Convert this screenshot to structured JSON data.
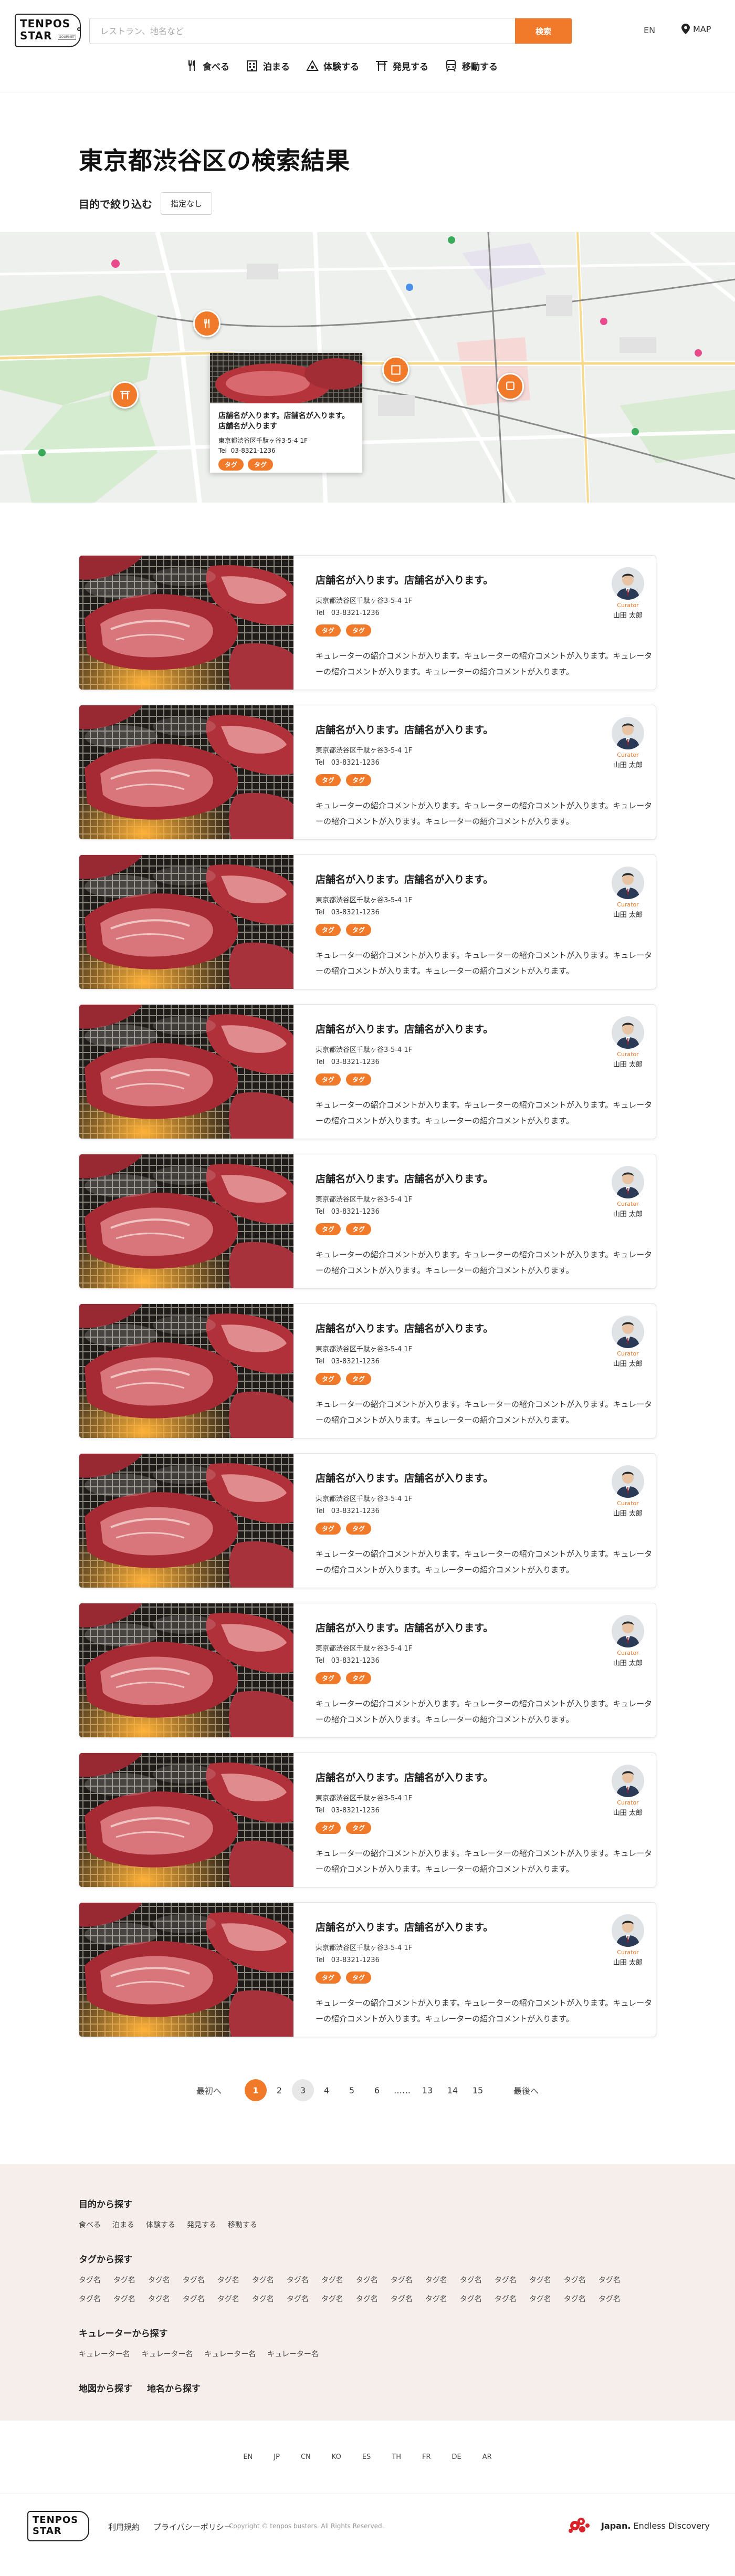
{
  "header": {
    "logo_line1": "TENPOS",
    "logo_line2": "STAR",
    "logo_badge": "GOURMET",
    "search_placeholder": "レストラン、地名など",
    "search_button": "検索",
    "lang": "EN",
    "map_label": "MAP",
    "nav": [
      {
        "label": "食べる",
        "icon": "fork-knife-icon"
      },
      {
        "label": "泊まる",
        "icon": "hotel-building-icon"
      },
      {
        "label": "体験する",
        "icon": "experience-icon"
      },
      {
        "label": "発見する",
        "icon": "torii-gate-icon"
      },
      {
        "label": "移動する",
        "icon": "train-icon"
      }
    ]
  },
  "title": {
    "text": "東京都渋谷区の検索結果",
    "filter_label": "目的で絞り込む",
    "filter_button": "指定なし"
  },
  "map_popup": {
    "name": "店舗名が入ります。店舗名が入ります。店舗名が入ります",
    "address": "東京都渋谷区千駄ヶ谷3-5-4 1F",
    "tel_label": "Tel",
    "tel": "03-8321-1236",
    "tags": [
      "タグ",
      "タグ"
    ]
  },
  "map": {
    "accent": "#f07a2a"
  },
  "results": [
    {
      "name": "店舗名が入ります。店舗名が入ります。",
      "address": "東京都渋谷区千駄ヶ谷3-5-4 1F",
      "tel_label": "Tel",
      "tel": "03-8321-1236",
      "tags": [
        "タグ",
        "タグ"
      ],
      "comment": "キュレーターの紹介コメントが入ります。キュレーターの紹介コメントが入ります。キュレーターの紹介コメントが入ります。キュレーターの紹介コメントが入ります。",
      "curator_role": "Curator",
      "curator_name": "山田 太郎"
    },
    {
      "name": "店舗名が入ります。店舗名が入ります。",
      "address": "東京都渋谷区千駄ヶ谷3-5-4 1F",
      "tel_label": "Tel",
      "tel": "03-8321-1236",
      "tags": [
        "タグ",
        "タグ"
      ],
      "comment": "キュレーターの紹介コメントが入ります。キュレーターの紹介コメントが入ります。キュレーターの紹介コメントが入ります。キュレーターの紹介コメントが入ります。",
      "curator_role": "Curator",
      "curator_name": "山田 太郎"
    },
    {
      "name": "店舗名が入ります。店舗名が入ります。",
      "address": "東京都渋谷区千駄ヶ谷3-5-4 1F",
      "tel_label": "Tel",
      "tel": "03-8321-1236",
      "tags": [
        "タグ",
        "タグ"
      ],
      "comment": "キュレーターの紹介コメントが入ります。キュレーターの紹介コメントが入ります。キュレーターの紹介コメントが入ります。キュレーターの紹介コメントが入ります。",
      "curator_role": "Curator",
      "curator_name": "山田 太郎"
    },
    {
      "name": "店舗名が入ります。店舗名が入ります。",
      "address": "東京都渋谷区千駄ヶ谷3-5-4 1F",
      "tel_label": "Tel",
      "tel": "03-8321-1236",
      "tags": [
        "タグ",
        "タグ"
      ],
      "comment": "キュレーターの紹介コメントが入ります。キュレーターの紹介コメントが入ります。キュレーターの紹介コメントが入ります。キュレーターの紹介コメントが入ります。",
      "curator_role": "Curator",
      "curator_name": "山田 太郎"
    },
    {
      "name": "店舗名が入ります。店舗名が入ります。",
      "address": "東京都渋谷区千駄ヶ谷3-5-4 1F",
      "tel_label": "Tel",
      "tel": "03-8321-1236",
      "tags": [
        "タグ",
        "タグ"
      ],
      "comment": "キュレーターの紹介コメントが入ります。キュレーターの紹介コメントが入ります。キュレーターの紹介コメントが入ります。キュレーターの紹介コメントが入ります。",
      "curator_role": "Curator",
      "curator_name": "山田 太郎"
    },
    {
      "name": "店舗名が入ります。店舗名が入ります。",
      "address": "東京都渋谷区千駄ヶ谷3-5-4 1F",
      "tel_label": "Tel",
      "tel": "03-8321-1236",
      "tags": [
        "タグ",
        "タグ"
      ],
      "comment": "キュレーターの紹介コメントが入ります。キュレーターの紹介コメントが入ります。キュレーターの紹介コメントが入ります。キュレーターの紹介コメントが入ります。",
      "curator_role": "Curator",
      "curator_name": "山田 太郎"
    },
    {
      "name": "店舗名が入ります。店舗名が入ります。",
      "address": "東京都渋谷区千駄ヶ谷3-5-4 1F",
      "tel_label": "Tel",
      "tel": "03-8321-1236",
      "tags": [
        "タグ",
        "タグ"
      ],
      "comment": "キュレーターの紹介コメントが入ります。キュレーターの紹介コメントが入ります。キュレーターの紹介コメントが入ります。キュレーターの紹介コメントが入ります。",
      "curator_role": "Curator",
      "curator_name": "山田 太郎"
    },
    {
      "name": "店舗名が入ります。店舗名が入ります。",
      "address": "東京都渋谷区千駄ヶ谷3-5-4 1F",
      "tel_label": "Tel",
      "tel": "03-8321-1236",
      "tags": [
        "タグ",
        "タグ"
      ],
      "comment": "キュレーターの紹介コメントが入ります。キュレーターの紹介コメントが入ります。キュレーターの紹介コメントが入ります。キュレーターの紹介コメントが入ります。",
      "curator_role": "Curator",
      "curator_name": "山田 太郎"
    },
    {
      "name": "店舗名が入ります。店舗名が入ります。",
      "address": "東京都渋谷区千駄ヶ谷3-5-4 1F",
      "tel_label": "Tel",
      "tel": "03-8321-1236",
      "tags": [
        "タグ",
        "タグ"
      ],
      "comment": "キュレーターの紹介コメントが入ります。キュレーターの紹介コメントが入ります。キュレーターの紹介コメントが入ります。キュレーターの紹介コメントが入ります。",
      "curator_role": "Curator",
      "curator_name": "山田 太郎"
    },
    {
      "name": "店舗名が入ります。店舗名が入ります。",
      "address": "東京都渋谷区千駄ヶ谷3-5-4 1F",
      "tel_label": "Tel",
      "tel": "03-8321-1236",
      "tags": [
        "タグ",
        "タグ"
      ],
      "comment": "キュレーターの紹介コメントが入ります。キュレーターの紹介コメントが入ります。キュレーターの紹介コメントが入ります。キュレーターの紹介コメントが入ります。",
      "curator_role": "Curator",
      "curator_name": "山田 太郎"
    }
  ],
  "pagination": {
    "prev": "最初へ",
    "pages": [
      "1",
      "2",
      "3",
      "4",
      "5",
      "6",
      "……",
      "13",
      "14",
      "15"
    ],
    "current": "1",
    "hover": "3",
    "next": "最後へ"
  },
  "footer_links": {
    "purpose_title": "目的から探す",
    "purpose_items": [
      "食べる",
      "泊まる",
      "体験する",
      "発見する",
      "移動する"
    ],
    "tag_title": "タグから探す",
    "tag_items": [
      "タグ名",
      "タグ名",
      "タグ名",
      "タグ名",
      "タグ名",
      "タグ名",
      "タグ名",
      "タグ名",
      "タグ名",
      "タグ名",
      "タグ名",
      "タグ名",
      "タグ名",
      "タグ名",
      "タグ名",
      "タグ名",
      "タグ名",
      "タグ名",
      "タグ名",
      "タグ名",
      "タグ名",
      "タグ名",
      "タグ名",
      "タグ名",
      "タグ名",
      "タグ名",
      "タグ名",
      "タグ名",
      "タグ名",
      "タグ名",
      "タグ名",
      "タグ名"
    ],
    "curator_title": "キュレーターから探す",
    "curator_items": [
      "キュレーター名",
      "キュレーター名",
      "キュレーター名",
      "キュレーター名"
    ],
    "map_title": "地図から探す",
    "area_title": "地名から探す"
  },
  "languages": [
    "EN",
    "JP",
    "CN",
    "KO",
    "ES",
    "TH",
    "FR",
    "DE",
    "AR"
  ],
  "bottom": {
    "logo_line1": "TENPOS",
    "logo_line2": "STAR",
    "terms": "利用規約",
    "privacy": "プライバシーポリシー",
    "copyright": "Copyright © tenpos busters. All Rights Reserved.",
    "japan_brand": "Japan.",
    "japan_tagline": "Endless Discovery"
  }
}
